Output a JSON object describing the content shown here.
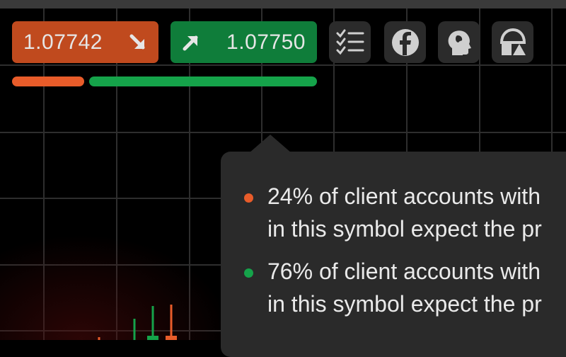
{
  "trade": {
    "sell_price": "1.07742",
    "buy_price": "1.07750",
    "colors": {
      "sell": "#c04a1e",
      "buy": "#0f7d3a",
      "sell_bar": "#e85c2a",
      "buy_bar": "#15a34a"
    }
  },
  "sentiment": {
    "sell_share": 0.24,
    "buy_share": 0.76,
    "sell_line1": "24% of client accounts with",
    "sell_line2": "in this symbol expect the pr",
    "buy_line1": "76% of client accounts with",
    "buy_line2": "in this symbol expect the pr"
  },
  "toolbar": {
    "icons": [
      "checklist-icon",
      "facebook-icon",
      "head-profile-icon",
      "shapes-icon"
    ]
  }
}
